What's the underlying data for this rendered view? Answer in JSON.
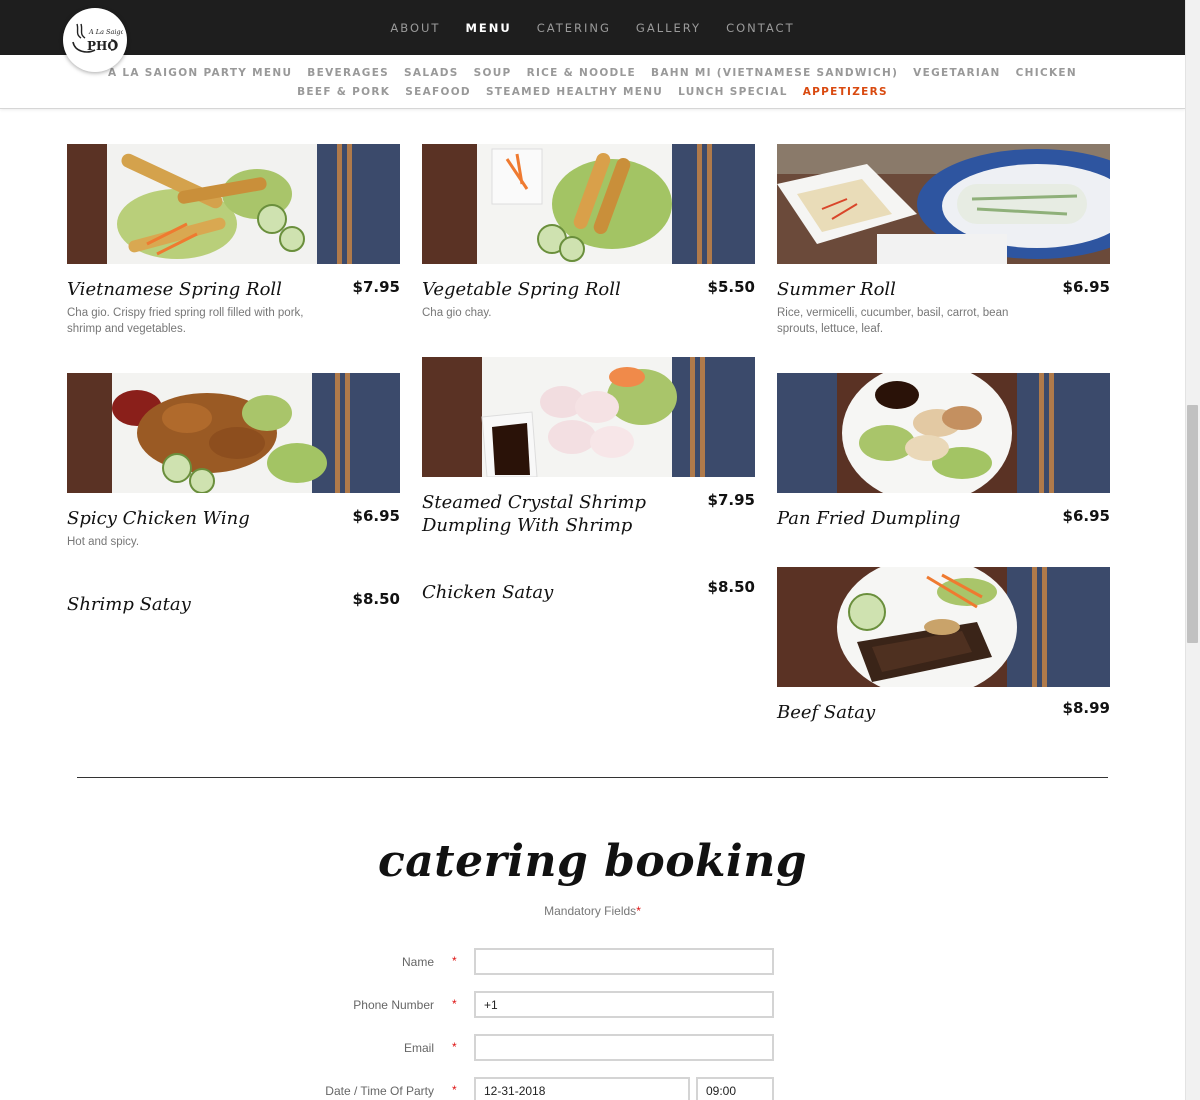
{
  "logo": {
    "text": "A La Saigon PHO"
  },
  "topnav": [
    {
      "label": "ABOUT",
      "active": false
    },
    {
      "label": "MENU",
      "active": true
    },
    {
      "label": "CATERING",
      "active": false
    },
    {
      "label": "GALLERY",
      "active": false
    },
    {
      "label": "CONTACT",
      "active": false
    }
  ],
  "subnav": {
    "row1": [
      "A LA SAIGON PARTY MENU",
      "BEVERAGES",
      "SALADS",
      "SOUP",
      "RICE & NOODLE",
      "BAHN MI (VIETNAMESE SANDWICH)",
      "VEGETARIAN",
      "CHICKEN"
    ],
    "row2": [
      "BEEF & PORK",
      "SEAFOOD",
      "STEAMED HEALTHY MENU",
      "LUNCH SPECIAL",
      "APPETIZERS"
    ],
    "active": "APPETIZERS"
  },
  "menu_items": [
    {
      "name": "Vietnamese Spring Roll",
      "price": "$7.95",
      "description": "Cha gio. Crispy fried spring roll filled with pork, shrimp and vegetables.",
      "photo": "spring-roll-photo"
    },
    {
      "name": "Vegetable Spring Roll",
      "price": "$5.50",
      "description": "Cha gio chay.",
      "photo": "veg-spring-roll-photo"
    },
    {
      "name": "Summer Roll",
      "price": "$6.95",
      "description": "Rice, vermicelli, cucumber, basil, carrot, bean sprouts, lettuce, leaf.",
      "photo": "summer-roll-photo"
    },
    {
      "name": "Spicy Chicken Wing",
      "price": "$6.95",
      "description": "Hot and spicy.",
      "photo": "chicken-wing-photo"
    },
    {
      "name": "Steamed Crystal Shrimp Dumpling With Shrimp",
      "price": "$7.95",
      "description": "",
      "photo": "crystal-dumpling-photo"
    },
    {
      "name": "Pan Fried Dumpling",
      "price": "$6.95",
      "description": "",
      "photo": "pan-fried-dumpling-photo"
    },
    {
      "name": "Shrimp Satay",
      "price": "$8.50",
      "description": "",
      "photo": ""
    },
    {
      "name": "Chicken Satay",
      "price": "$8.50",
      "description": "",
      "photo": ""
    },
    {
      "name": "Beef Satay",
      "price": "$8.99",
      "description": "",
      "photo": "beef-satay-photo"
    }
  ],
  "catering": {
    "title": "catering booking",
    "mandatory_note": "Mandatory Fields",
    "mandatory_star": "*",
    "fields": {
      "name": {
        "label": "Name",
        "value": ""
      },
      "phone": {
        "label": "Phone Number",
        "value": "+1"
      },
      "email": {
        "label": "Email",
        "value": ""
      },
      "datetime": {
        "label": "Date / Time Of Party",
        "date_value": "12-31-2018",
        "time_value": "09:00"
      }
    },
    "required_mark": "*"
  },
  "colors": {
    "topbar": "#1e1e1e",
    "accent": "#d94a10",
    "required": "#dd1111"
  }
}
